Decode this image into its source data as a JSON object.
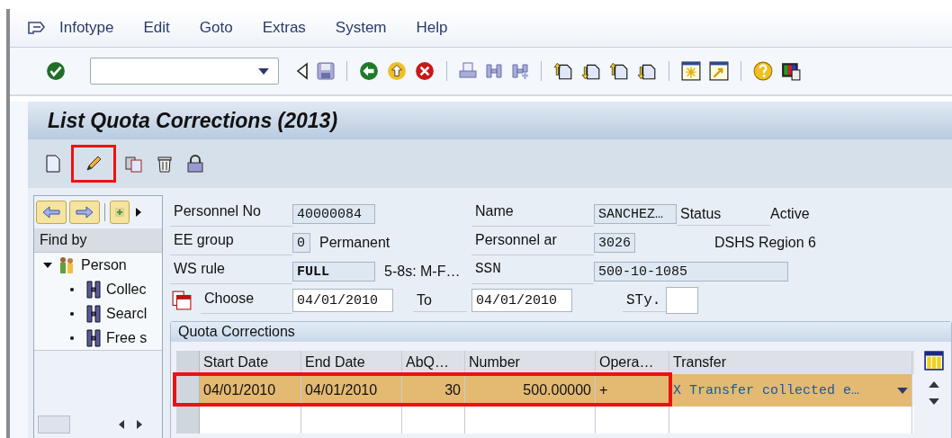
{
  "menu": [
    {
      "label": "Infotype"
    },
    {
      "label": "Edit"
    },
    {
      "label": "Goto"
    },
    {
      "label": "Extras"
    },
    {
      "label": "System"
    },
    {
      "label": "Help"
    }
  ],
  "title": "List Quota Corrections (2013)",
  "app_toolbar": [
    {
      "kind": "create",
      "highlighted": false
    },
    {
      "kind": "change",
      "highlighted": true
    },
    {
      "kind": "copy",
      "highlighted": false
    },
    {
      "kind": "delete",
      "highlighted": false
    },
    {
      "kind": "lock",
      "highlighted": false
    }
  ],
  "sidebar": {
    "heading": "Find by",
    "tree": [
      {
        "label": "Person",
        "expanded": true,
        "children": [
          {
            "label": "Collec"
          },
          {
            "label": "Searcl"
          },
          {
            "label": "Free s"
          }
        ]
      }
    ]
  },
  "header": {
    "personnel_no": {
      "label": "Personnel No",
      "value": "40000084"
    },
    "name": {
      "label": "Name",
      "value": "SANCHEZ…"
    },
    "status": {
      "label": "Status",
      "value": "Active"
    },
    "ee_group": {
      "label": "EE group",
      "value": "0",
      "text": "Permanent"
    },
    "personnel_area": {
      "label": "Personnel ar",
      "value": "3026",
      "text": "DSHS Region 6"
    },
    "ws_rule": {
      "label": "WS rule",
      "value": "FULL",
      "text": "5-8s:  M-F…"
    },
    "ssn": {
      "label": "SSN",
      "value": "500-10-1085"
    },
    "choose": {
      "label": "Choose",
      "from": "04/01/2010",
      "to_label": "To",
      "to": "04/01/2010",
      "sty_label": "STy."
    }
  },
  "table": {
    "title": "Quota Corrections",
    "columns": [
      "Start Date",
      "End Date",
      "AbQ…",
      "Number",
      "Opera…",
      "Transfer"
    ],
    "rows": [
      {
        "cells": [
          "04/01/2010",
          "04/01/2010",
          "30",
          "500.00000",
          "+",
          "X Transfer collected e…"
        ],
        "highlighted": true
      }
    ]
  }
}
